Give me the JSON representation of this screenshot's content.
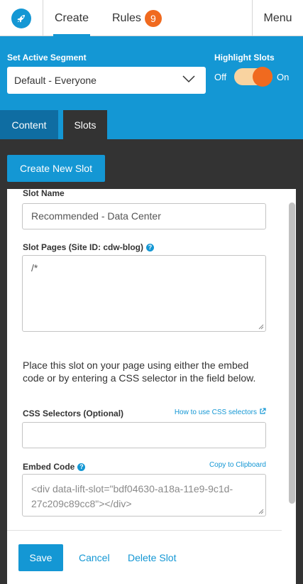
{
  "topnav": {
    "logo_icon": "rocket-icon",
    "create_label": "Create",
    "rules_label": "Rules",
    "rules_count": "9",
    "menu_label": "Menu"
  },
  "segment": {
    "label": "Set Active Segment",
    "selected": "Default - Everyone"
  },
  "highlight": {
    "label": "Highlight Slots",
    "off_label": "Off",
    "on_label": "On",
    "state": "on"
  },
  "subtabs": {
    "content": "Content",
    "slots": "Slots"
  },
  "create_new_slot": "Create New Slot",
  "form": {
    "slot_name_label": "Slot Name",
    "slot_name_value": "Recommended - Data Center",
    "slot_pages_label": "Slot Pages (Site ID: cdw-blog)",
    "slot_pages_value": "/*",
    "instructions": "Place this slot on your page using either the embed code or by entering a CSS selector in the field below.",
    "css_selectors_label": "CSS Selectors (Optional)",
    "css_help_link": "How to use CSS selectors",
    "css_selectors_value": "",
    "embed_code_label": "Embed Code",
    "copy_link": "Copy to Clipboard",
    "embed_code_value": "<div data-lift-slot=\"bdf04630-a18a-11e9-9c1d-27c209c89cc8\"></div>"
  },
  "actions": {
    "save": "Save",
    "cancel": "Cancel",
    "delete": "Delete Slot"
  },
  "colors": {
    "brand_blue": "#1497d4",
    "dark_blue": "#0f6da2",
    "orange": "#f06a1f",
    "dark_bg": "#333333"
  }
}
